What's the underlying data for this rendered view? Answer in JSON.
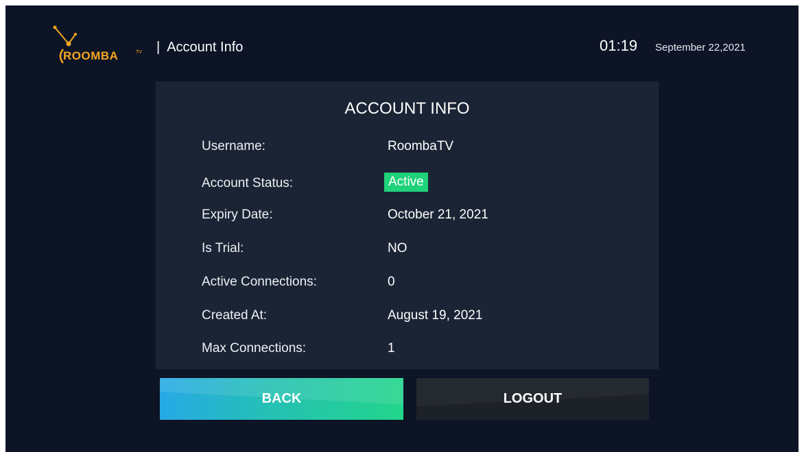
{
  "brand": {
    "logo_text": "ROOMBA",
    "logo_tm": "TV",
    "accent_color": "#f6a623"
  },
  "header": {
    "separator": "|",
    "title": "Account Info",
    "time": "01:19",
    "date": "September 22,2021"
  },
  "card": {
    "title": "ACCOUNT INFO",
    "rows": [
      {
        "label": "Username:",
        "value": "RoombaTV"
      },
      {
        "label": "Account Status:",
        "value": "Active"
      },
      {
        "label": "Expiry Date:",
        "value": "October 21, 2021"
      },
      {
        "label": "Is Trial:",
        "value": "NO"
      },
      {
        "label": "Active Connections:",
        "value": "0"
      },
      {
        "label": "Created At:",
        "value": "August 19, 2021"
      },
      {
        "label": "Max Connections:",
        "value": "1"
      }
    ],
    "status_color": "#1fd27a"
  },
  "buttons": {
    "back_label": "BACK",
    "logout_label": "LOGOUT"
  },
  "colors": {
    "background": "#0d1426",
    "card": "#1b2435",
    "back_gradient_start": "#26a9e6",
    "back_gradient_end": "#22d58a",
    "logout_bg": "#1d2128"
  }
}
